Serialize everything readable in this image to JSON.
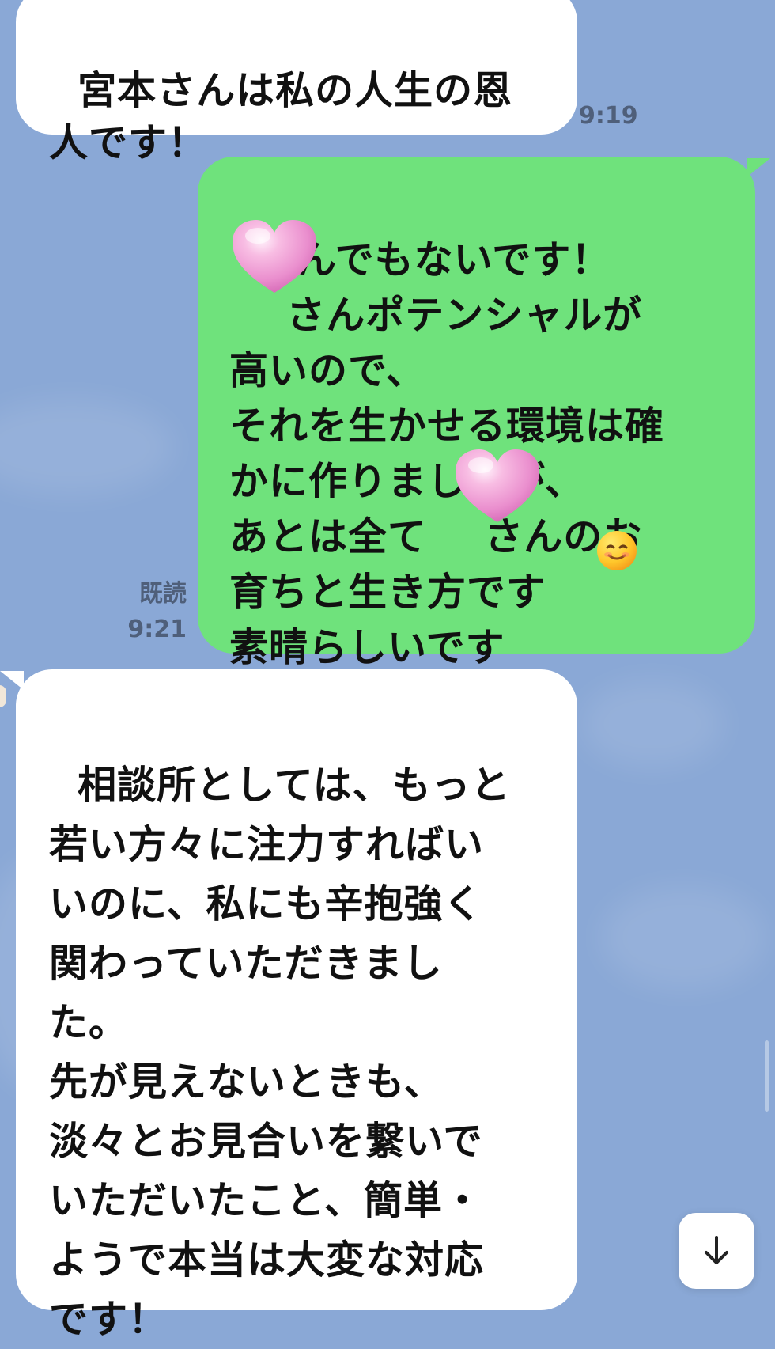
{
  "chat": {
    "messages": [
      {
        "side": "in",
        "text": "宮本さんは私の人生の恩\n人です！",
        "time": "9:19"
      },
      {
        "side": "out",
        "text": "とんでもないです！\n    さんポテンシャルが\n高いので、\nそれを生かせる環境は確\nかに作りましたが、\nあとは全て    さんのお\n育ちと生き方です\n素晴らしいです",
        "read": "既読",
        "time": "9:21"
      },
      {
        "side": "in",
        "text": "相談所としては、もっと\n若い方々に注力すればい\nいのに、私にも辛抱強く\n関わっていただきまし\nた。\n先が見えないときも、\n淡々とお見合いを繋いで\nいただいたこと、簡単・\nようで本当は大変な対応\nです！"
      }
    ]
  },
  "icons": {
    "heart_sticker": "heart-sticker-icon",
    "emoji": "smiling-face-icon",
    "scroll_down": "arrow-down-icon"
  },
  "colors": {
    "background": "#8aa8d6",
    "bubble_incoming": "#ffffff",
    "bubble_outgoing": "#6fe27c",
    "meta_text": "#4f5f7a",
    "heart_pink": "#f4a6d8"
  }
}
